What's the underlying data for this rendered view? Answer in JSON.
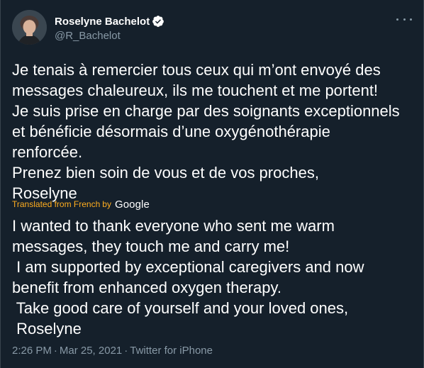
{
  "author": {
    "display_name": "Roselyne Bachelot",
    "handle": "@R_Bachelot",
    "verified": true
  },
  "tweet": {
    "original_lines": [
      "Je tenais à remercier tous ceux qui m’ont envoyé des",
      "messages chaleureux, ils me touchent et me portent!",
      "Je suis prise en charge par des soignants exceptionnels",
      "et bénéficie désormais d’une oxygénothérapie",
      "renforcée.",
      "Prenez bien soin de vous et de vos proches,",
      "Roselyne"
    ],
    "translation_credit": {
      "label": "Translated from French",
      "by": "by",
      "provider": "Google"
    },
    "translated_lines": [
      "I wanted to thank everyone who sent me warm",
      "messages, they touch me and carry me!",
      " I am supported by exceptional caregivers and now",
      "benefit from enhanced oxygen therapy.",
      " Take good care of yourself and your loved ones,",
      " Roselyne"
    ],
    "time": "2:26 PM",
    "separator": "·",
    "date": "Mar 25, 2021",
    "source": "Twitter for iPhone"
  },
  "colors": {
    "background": "#15202b",
    "text": "#ffffff",
    "secondary": "#8899a6",
    "translation": "#ffad1f",
    "verified_badge": "#ffffff"
  },
  "icons": {
    "verified": "verified-badge-icon",
    "more": "more-options-icon",
    "avatar": "profile-photo"
  }
}
